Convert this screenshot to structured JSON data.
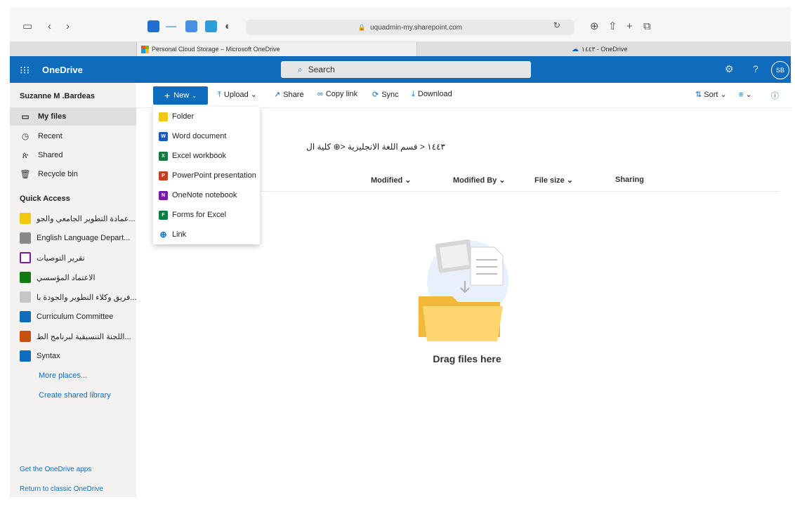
{
  "browser": {
    "url": "uquadmin-my.sharepoint.com",
    "tabs": [
      {
        "title": "Personal Cloud Storage – Microsoft OneDrive"
      },
      {
        "title": "١٤٤٣ - OneDrive"
      }
    ]
  },
  "header": {
    "app_name": "OneDrive",
    "search_placeholder": "Search",
    "avatar_initials": "SB"
  },
  "user": {
    "name": "Suzanne M .Bardeas"
  },
  "nav": {
    "items": [
      {
        "label": "My files",
        "icon": "folder-icon"
      },
      {
        "label": "Recent",
        "icon": "clock-icon"
      },
      {
        "label": "Shared",
        "icon": "people-icon"
      },
      {
        "label": "Recycle bin",
        "icon": "trash-icon"
      }
    ],
    "quick_access_title": "Quick Access",
    "quick_access": [
      {
        "label": "عمادة التطوير الجامعي والجو...",
        "color": "#f2c811"
      },
      {
        "label": "English Language Depart...",
        "color": "#8a8886"
      },
      {
        "label": "تقرير التوصيات",
        "color": "#7719aa"
      },
      {
        "label": "الاعتماد المؤسسي",
        "color": "#107c10"
      },
      {
        "label": "فريق وكلاء التطوير والجودة با...",
        "color": "#c8c6c4"
      },
      {
        "label": "Curriculum Committee",
        "color": "#0f6cbd"
      },
      {
        "label": "اللجنة التنسيقية لبرنامج الط...",
        "color": "#ca5010"
      },
      {
        "label": "Syntax",
        "color": "#0f6cbd"
      }
    ],
    "more_places": "More places...",
    "create_shared_library": "Create shared library",
    "get_apps": "Get the OneDrive apps",
    "return_classic": "Return to classic OneDrive"
  },
  "commands": {
    "new": "New",
    "upload": "Upload",
    "share": "Share",
    "copy_link": "Copy link",
    "sync": "Sync",
    "download": "Download",
    "sort": "Sort"
  },
  "new_menu": [
    {
      "label": "Folder",
      "color": "#f2c811",
      "glyph": ""
    },
    {
      "label": "Word document",
      "color": "#185abd",
      "glyph": "W"
    },
    {
      "label": "Excel workbook",
      "color": "#107c41",
      "glyph": "X"
    },
    {
      "label": "PowerPoint presentation",
      "color": "#c43e1c",
      "glyph": "P"
    },
    {
      "label": "OneNote notebook",
      "color": "#7719aa",
      "glyph": "N"
    },
    {
      "label": "Forms for Excel",
      "color": "#107c41",
      "glyph": "F"
    },
    {
      "label": "Link",
      "color": "#0f6cbd",
      "glyph": ""
    }
  ],
  "main": {
    "breadcrumb": "١٤٤٣ < قسم اللغة الانجليزية <⊕ كلية ال",
    "columns": [
      "Modified",
      "Modified By",
      "File size",
      "Sharing"
    ],
    "empty_text": "Drag files here"
  }
}
